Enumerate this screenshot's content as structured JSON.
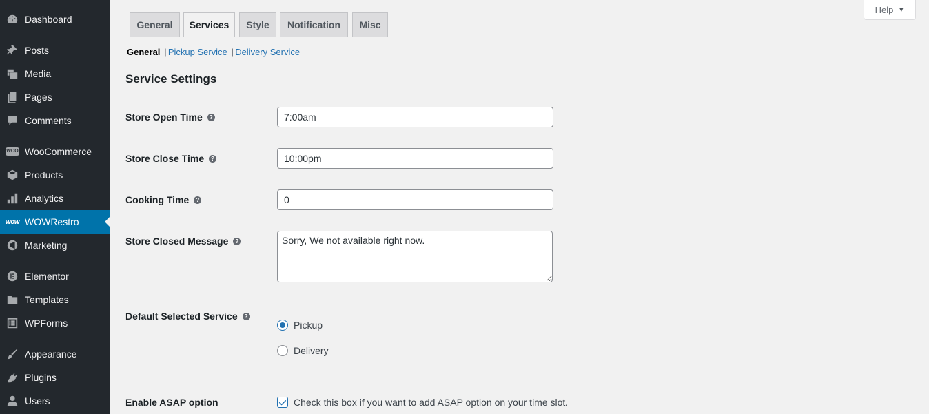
{
  "sidebar": {
    "items": [
      {
        "label": "Dashboard",
        "icon": "dashboard-icon"
      },
      {
        "label": "Posts",
        "icon": "pin-icon"
      },
      {
        "label": "Media",
        "icon": "media-icon"
      },
      {
        "label": "Pages",
        "icon": "pages-icon"
      },
      {
        "label": "Comments",
        "icon": "comment-icon"
      },
      {
        "label": "WooCommerce",
        "icon": "woo-icon",
        "badge": "WOO"
      },
      {
        "label": "Products",
        "icon": "box-icon"
      },
      {
        "label": "Analytics",
        "icon": "bar-chart-icon"
      },
      {
        "label": "WOWRestro",
        "icon": "wow-icon",
        "badge": "wow",
        "active": true
      },
      {
        "label": "Marketing",
        "icon": "megaphone-icon"
      },
      {
        "label": "Elementor",
        "icon": "elementor-icon"
      },
      {
        "label": "Templates",
        "icon": "folder-icon"
      },
      {
        "label": "WPForms",
        "icon": "form-icon"
      },
      {
        "label": "Appearance",
        "icon": "brush-icon"
      },
      {
        "label": "Plugins",
        "icon": "plug-icon"
      },
      {
        "label": "Users",
        "icon": "user-icon"
      }
    ]
  },
  "help": {
    "label": "Help",
    "caret": "▼"
  },
  "tabs": [
    {
      "label": "General"
    },
    {
      "label": "Services",
      "active": true
    },
    {
      "label": "Style"
    },
    {
      "label": "Notification"
    },
    {
      "label": "Misc"
    }
  ],
  "subnav": {
    "current": "General",
    "sep": "|",
    "links": [
      "Pickup Service",
      "Delivery Service"
    ]
  },
  "section_title": "Service Settings",
  "help_glyph": "?",
  "fields": {
    "open_time": {
      "label": "Store Open Time",
      "value": "7:00am"
    },
    "close_time": {
      "label": "Store Close Time",
      "value": "10:00pm"
    },
    "cooking_time": {
      "label": "Cooking Time",
      "value": "0"
    },
    "closed_message": {
      "label": "Store Closed Message",
      "value": "Sorry, We not available right now."
    },
    "default_service": {
      "label": "Default Selected Service",
      "options": [
        {
          "label": "Pickup",
          "checked": true
        },
        {
          "label": "Delivery",
          "checked": false
        }
      ]
    },
    "asap": {
      "label": "Enable ASAP option",
      "checkbox_label": "Check this box if you want to add ASAP option on your time slot.",
      "checked": true
    }
  },
  "colors": {
    "sidebar_bg": "#23282d",
    "accent": "#0073aa",
    "link": "#2271b1",
    "body_bg": "#f1f1f1"
  }
}
